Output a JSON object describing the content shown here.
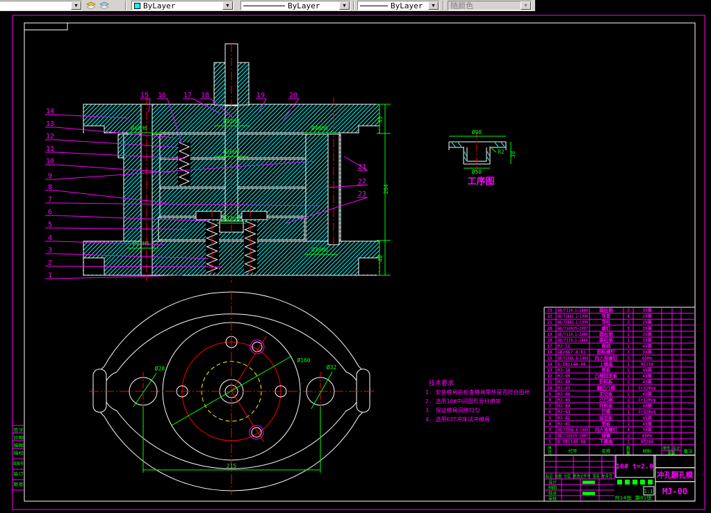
{
  "toolbar": {
    "color_combo": {
      "value": "ByLayer",
      "swatch": "#00ffff"
    },
    "linetype_combo": {
      "value": "ByLayer"
    },
    "lineweight_combo": {
      "value": "ByLayer"
    },
    "plotstyle_combo": {
      "value": "随颜色",
      "disabled": true
    }
  },
  "colors": {
    "magenta": "#ff00ff",
    "green": "#00ff00",
    "red": "#ff0000",
    "cyan": "#00ffff",
    "white": "#ffffff",
    "yellow": "#ffff00"
  },
  "section_view": {
    "callouts_left": [
      "14",
      "13",
      "12",
      "11",
      "10",
      "9",
      "8",
      "7",
      "6",
      "5",
      "4",
      "3",
      "2",
      "1"
    ],
    "callouts_top": [
      "15",
      "16",
      "17",
      "18",
      "19",
      "20"
    ],
    "callouts_right": [
      "21",
      "22",
      "23"
    ],
    "dims": [
      "Ø40H6",
      "Ø42H6",
      "Ø48H6",
      "Ø36H8",
      "Ø14H7",
      "Ø23H6",
      "Ø38H6"
    ],
    "vdims": [
      "35",
      "204",
      "40"
    ]
  },
  "plan_view": {
    "dims": {
      "bolt_circle": "Ø160",
      "left_hole": "Ø28",
      "right_hole": "Ø32",
      "width": "215"
    }
  },
  "process_view": {
    "title": "工序图",
    "dims": {
      "top": "Ø98",
      "bottom": "Ø58",
      "radius": "R2",
      "height": "38"
    }
  },
  "notes": {
    "title": "技术要求",
    "items": [
      "1. 安装模具前检查模具零件是否符合图样",
      "2. 选用10#中间圆形导柱模架",
      "3. 保证模具间隙均匀",
      "4. 选用63T冲床试冲模具"
    ]
  },
  "bom": {
    "headers": [
      "序号",
      "代号",
      "名称",
      "数量",
      "材料",
      "单件",
      "总计",
      "重量",
      "备注"
    ],
    "rows": [
      [
        "23",
        "GB/T119.1-2000",
        "圆柱销",
        "2",
        "35钢"
      ],
      [
        "22",
        "GB/T2861.1-1990",
        "导套",
        "4",
        "25钢"
      ],
      [
        "21",
        "GB/T2861.1-1990",
        "导柱",
        "2",
        "25钢"
      ],
      [
        "20",
        "GB/T16925-1997",
        "螺钉",
        "3",
        "35钢"
      ],
      [
        "19",
        "GB/T119.1-2000",
        "圆柱销",
        "1",
        "35钢"
      ],
      [
        "18",
        "GB/T119.1-2000",
        "圆柱销",
        "1",
        "35钢"
      ],
      [
        "17",
        "MJ-11",
        "模柄",
        "1",
        "45钢"
      ],
      [
        "16",
        "GB2867.4-81",
        "卸料螺钉",
        "3",
        "35钢"
      ],
      [
        "15",
        "GB/T2346.6-1988",
        "内六角螺钉",
        "3",
        "65Mn"
      ],
      [
        "14",
        "Q/ZB1144-86",
        "上模座",
        "1",
        "HT250"
      ],
      [
        "13",
        "MJ-10",
        "垫板",
        "1",
        "45钢"
      ],
      [
        "12",
        "MJ-09",
        "凸模固定板",
        "1",
        "45钢"
      ],
      [
        "11",
        "MJ-08",
        "卸料板",
        "1",
        "45钢"
      ],
      [
        "10",
        "MJ-07",
        "翻边凸模",
        "1",
        "Cr12MoV"
      ],
      [
        "9",
        "MJ-06",
        "定位板",
        "1",
        "45钢"
      ],
      [
        "8",
        "MJ-05",
        "凸凹模",
        "1",
        "Cr12MoV"
      ],
      [
        "7",
        "MJ-04",
        "托料板",
        "1",
        "45钢"
      ],
      [
        "6",
        "MJ-03",
        "凹模",
        "1",
        "Cr12MoV"
      ],
      [
        "5",
        "MJ-02",
        "固定板",
        "1",
        "45钢"
      ],
      [
        "4",
        "MJ-01",
        "垫板",
        "1",
        "45钢"
      ],
      [
        "3",
        "GB/T2346.6-1988",
        "内六角螺钉",
        "4",
        "35钢"
      ],
      [
        "2",
        "GB/T16925-1997",
        "弹簧",
        "2",
        "65Mn"
      ],
      [
        "1",
        "Q/ZB1145-86",
        "下模座",
        "1",
        "HT200"
      ]
    ]
  },
  "title_block": {
    "material_spec": "10# t=2.0",
    "drawing_name": "冲孔翻孔模",
    "drawing_code": "MJ-00",
    "scale": "1:1",
    "sheet_info": "共14张 第01张",
    "rev_row": "标记 处数 分区 更改文件号 签名 年月日",
    "sign_rows": [
      "设计",
      "制图",
      "校对",
      "审核"
    ]
  },
  "side_strip": {
    "rows": [
      "签字",
      "日期",
      "描图",
      "描校",
      "底图号",
      "装订",
      "复查"
    ]
  }
}
